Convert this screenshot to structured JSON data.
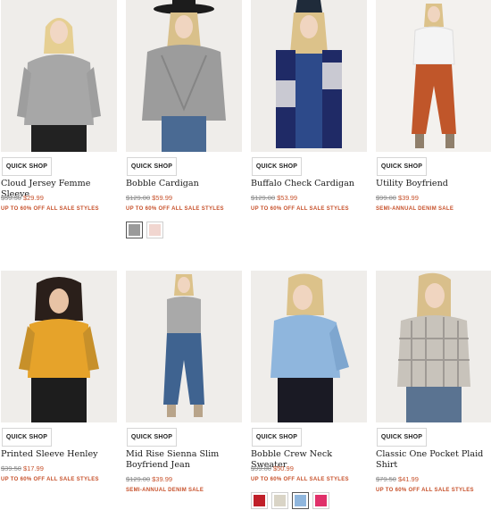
{
  "quick_shop_label": "QUICK SHOP",
  "products": [
    {
      "name": "Cloud Jersey Femme Sleeve",
      "orig": "$59.50",
      "sale": "$29.99",
      "promo": "UP TO 60% OFF ALL SALE STYLES",
      "swatches": []
    },
    {
      "name": "Bobble Cardigan",
      "orig": "$129.00",
      "sale": "$59.99",
      "promo": "UP TO 60% OFF ALL SALE STYLES",
      "swatches": [
        "#9a9a9a",
        "#f1d6d0"
      ]
    },
    {
      "name": "Buffalo Check Cardigan",
      "orig": "$129.00",
      "sale": "$53.99",
      "promo": "UP TO 60% OFF ALL SALE STYLES",
      "swatches": []
    },
    {
      "name": "Utility Boyfriend",
      "orig": "$99.00",
      "sale": "$39.99",
      "promo": "SEMI-ANNUAL DENIM SALE",
      "swatches": []
    },
    {
      "name": "Printed Sleeve Henley",
      "orig": "$39.50",
      "sale": "$17.99",
      "promo": "UP TO 60% OFF ALL SALE STYLES",
      "swatches": []
    },
    {
      "name": "Mid Rise Sienna Slim Boyfriend Jean",
      "orig": "$129.00",
      "sale": "$39.99",
      "promo": "SEMI-ANNUAL DENIM SALE",
      "swatches": []
    },
    {
      "name": "Bobble Crew Neck Sweater",
      "orig": "$99.00",
      "sale": "$50.99",
      "promo": "UP TO 60% OFF ALL SALE STYLES",
      "swatches": [
        "#c0202a",
        "#d9d4c6",
        "#8fb6dd",
        "#e0306a"
      ]
    },
    {
      "name": "Classic One Pocket Plaid Shirt",
      "orig": "$79.50",
      "sale": "$41.99",
      "promo": "UP TO 60% OFF ALL SALE STYLES",
      "swatches": []
    }
  ]
}
